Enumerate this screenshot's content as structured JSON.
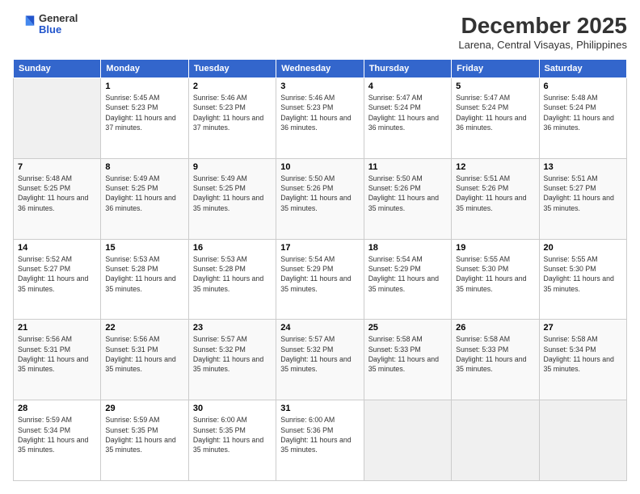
{
  "logo": {
    "general": "General",
    "blue": "Blue"
  },
  "header": {
    "month": "December 2025",
    "location": "Larena, Central Visayas, Philippines"
  },
  "days_of_week": [
    "Sunday",
    "Monday",
    "Tuesday",
    "Wednesday",
    "Thursday",
    "Friday",
    "Saturday"
  ],
  "weeks": [
    [
      {
        "day": "",
        "sunrise": "",
        "sunset": "",
        "daylight": ""
      },
      {
        "day": "1",
        "sunrise": "Sunrise: 5:45 AM",
        "sunset": "Sunset: 5:23 PM",
        "daylight": "Daylight: 11 hours and 37 minutes."
      },
      {
        "day": "2",
        "sunrise": "Sunrise: 5:46 AM",
        "sunset": "Sunset: 5:23 PM",
        "daylight": "Daylight: 11 hours and 37 minutes."
      },
      {
        "day": "3",
        "sunrise": "Sunrise: 5:46 AM",
        "sunset": "Sunset: 5:23 PM",
        "daylight": "Daylight: 11 hours and 36 minutes."
      },
      {
        "day": "4",
        "sunrise": "Sunrise: 5:47 AM",
        "sunset": "Sunset: 5:24 PM",
        "daylight": "Daylight: 11 hours and 36 minutes."
      },
      {
        "day": "5",
        "sunrise": "Sunrise: 5:47 AM",
        "sunset": "Sunset: 5:24 PM",
        "daylight": "Daylight: 11 hours and 36 minutes."
      },
      {
        "day": "6",
        "sunrise": "Sunrise: 5:48 AM",
        "sunset": "Sunset: 5:24 PM",
        "daylight": "Daylight: 11 hours and 36 minutes."
      }
    ],
    [
      {
        "day": "7",
        "sunrise": "Sunrise: 5:48 AM",
        "sunset": "Sunset: 5:25 PM",
        "daylight": "Daylight: 11 hours and 36 minutes."
      },
      {
        "day": "8",
        "sunrise": "Sunrise: 5:49 AM",
        "sunset": "Sunset: 5:25 PM",
        "daylight": "Daylight: 11 hours and 36 minutes."
      },
      {
        "day": "9",
        "sunrise": "Sunrise: 5:49 AM",
        "sunset": "Sunset: 5:25 PM",
        "daylight": "Daylight: 11 hours and 35 minutes."
      },
      {
        "day": "10",
        "sunrise": "Sunrise: 5:50 AM",
        "sunset": "Sunset: 5:26 PM",
        "daylight": "Daylight: 11 hours and 35 minutes."
      },
      {
        "day": "11",
        "sunrise": "Sunrise: 5:50 AM",
        "sunset": "Sunset: 5:26 PM",
        "daylight": "Daylight: 11 hours and 35 minutes."
      },
      {
        "day": "12",
        "sunrise": "Sunrise: 5:51 AM",
        "sunset": "Sunset: 5:26 PM",
        "daylight": "Daylight: 11 hours and 35 minutes."
      },
      {
        "day": "13",
        "sunrise": "Sunrise: 5:51 AM",
        "sunset": "Sunset: 5:27 PM",
        "daylight": "Daylight: 11 hours and 35 minutes."
      }
    ],
    [
      {
        "day": "14",
        "sunrise": "Sunrise: 5:52 AM",
        "sunset": "Sunset: 5:27 PM",
        "daylight": "Daylight: 11 hours and 35 minutes."
      },
      {
        "day": "15",
        "sunrise": "Sunrise: 5:53 AM",
        "sunset": "Sunset: 5:28 PM",
        "daylight": "Daylight: 11 hours and 35 minutes."
      },
      {
        "day": "16",
        "sunrise": "Sunrise: 5:53 AM",
        "sunset": "Sunset: 5:28 PM",
        "daylight": "Daylight: 11 hours and 35 minutes."
      },
      {
        "day": "17",
        "sunrise": "Sunrise: 5:54 AM",
        "sunset": "Sunset: 5:29 PM",
        "daylight": "Daylight: 11 hours and 35 minutes."
      },
      {
        "day": "18",
        "sunrise": "Sunrise: 5:54 AM",
        "sunset": "Sunset: 5:29 PM",
        "daylight": "Daylight: 11 hours and 35 minutes."
      },
      {
        "day": "19",
        "sunrise": "Sunrise: 5:55 AM",
        "sunset": "Sunset: 5:30 PM",
        "daylight": "Daylight: 11 hours and 35 minutes."
      },
      {
        "day": "20",
        "sunrise": "Sunrise: 5:55 AM",
        "sunset": "Sunset: 5:30 PM",
        "daylight": "Daylight: 11 hours and 35 minutes."
      }
    ],
    [
      {
        "day": "21",
        "sunrise": "Sunrise: 5:56 AM",
        "sunset": "Sunset: 5:31 PM",
        "daylight": "Daylight: 11 hours and 35 minutes."
      },
      {
        "day": "22",
        "sunrise": "Sunrise: 5:56 AM",
        "sunset": "Sunset: 5:31 PM",
        "daylight": "Daylight: 11 hours and 35 minutes."
      },
      {
        "day": "23",
        "sunrise": "Sunrise: 5:57 AM",
        "sunset": "Sunset: 5:32 PM",
        "daylight": "Daylight: 11 hours and 35 minutes."
      },
      {
        "day": "24",
        "sunrise": "Sunrise: 5:57 AM",
        "sunset": "Sunset: 5:32 PM",
        "daylight": "Daylight: 11 hours and 35 minutes."
      },
      {
        "day": "25",
        "sunrise": "Sunrise: 5:58 AM",
        "sunset": "Sunset: 5:33 PM",
        "daylight": "Daylight: 11 hours and 35 minutes."
      },
      {
        "day": "26",
        "sunrise": "Sunrise: 5:58 AM",
        "sunset": "Sunset: 5:33 PM",
        "daylight": "Daylight: 11 hours and 35 minutes."
      },
      {
        "day": "27",
        "sunrise": "Sunrise: 5:58 AM",
        "sunset": "Sunset: 5:34 PM",
        "daylight": "Daylight: 11 hours and 35 minutes."
      }
    ],
    [
      {
        "day": "28",
        "sunrise": "Sunrise: 5:59 AM",
        "sunset": "Sunset: 5:34 PM",
        "daylight": "Daylight: 11 hours and 35 minutes."
      },
      {
        "day": "29",
        "sunrise": "Sunrise: 5:59 AM",
        "sunset": "Sunset: 5:35 PM",
        "daylight": "Daylight: 11 hours and 35 minutes."
      },
      {
        "day": "30",
        "sunrise": "Sunrise: 6:00 AM",
        "sunset": "Sunset: 5:35 PM",
        "daylight": "Daylight: 11 hours and 35 minutes."
      },
      {
        "day": "31",
        "sunrise": "Sunrise: 6:00 AM",
        "sunset": "Sunset: 5:36 PM",
        "daylight": "Daylight: 11 hours and 35 minutes."
      },
      {
        "day": "",
        "sunrise": "",
        "sunset": "",
        "daylight": ""
      },
      {
        "day": "",
        "sunrise": "",
        "sunset": "",
        "daylight": ""
      },
      {
        "day": "",
        "sunrise": "",
        "sunset": "",
        "daylight": ""
      }
    ]
  ]
}
